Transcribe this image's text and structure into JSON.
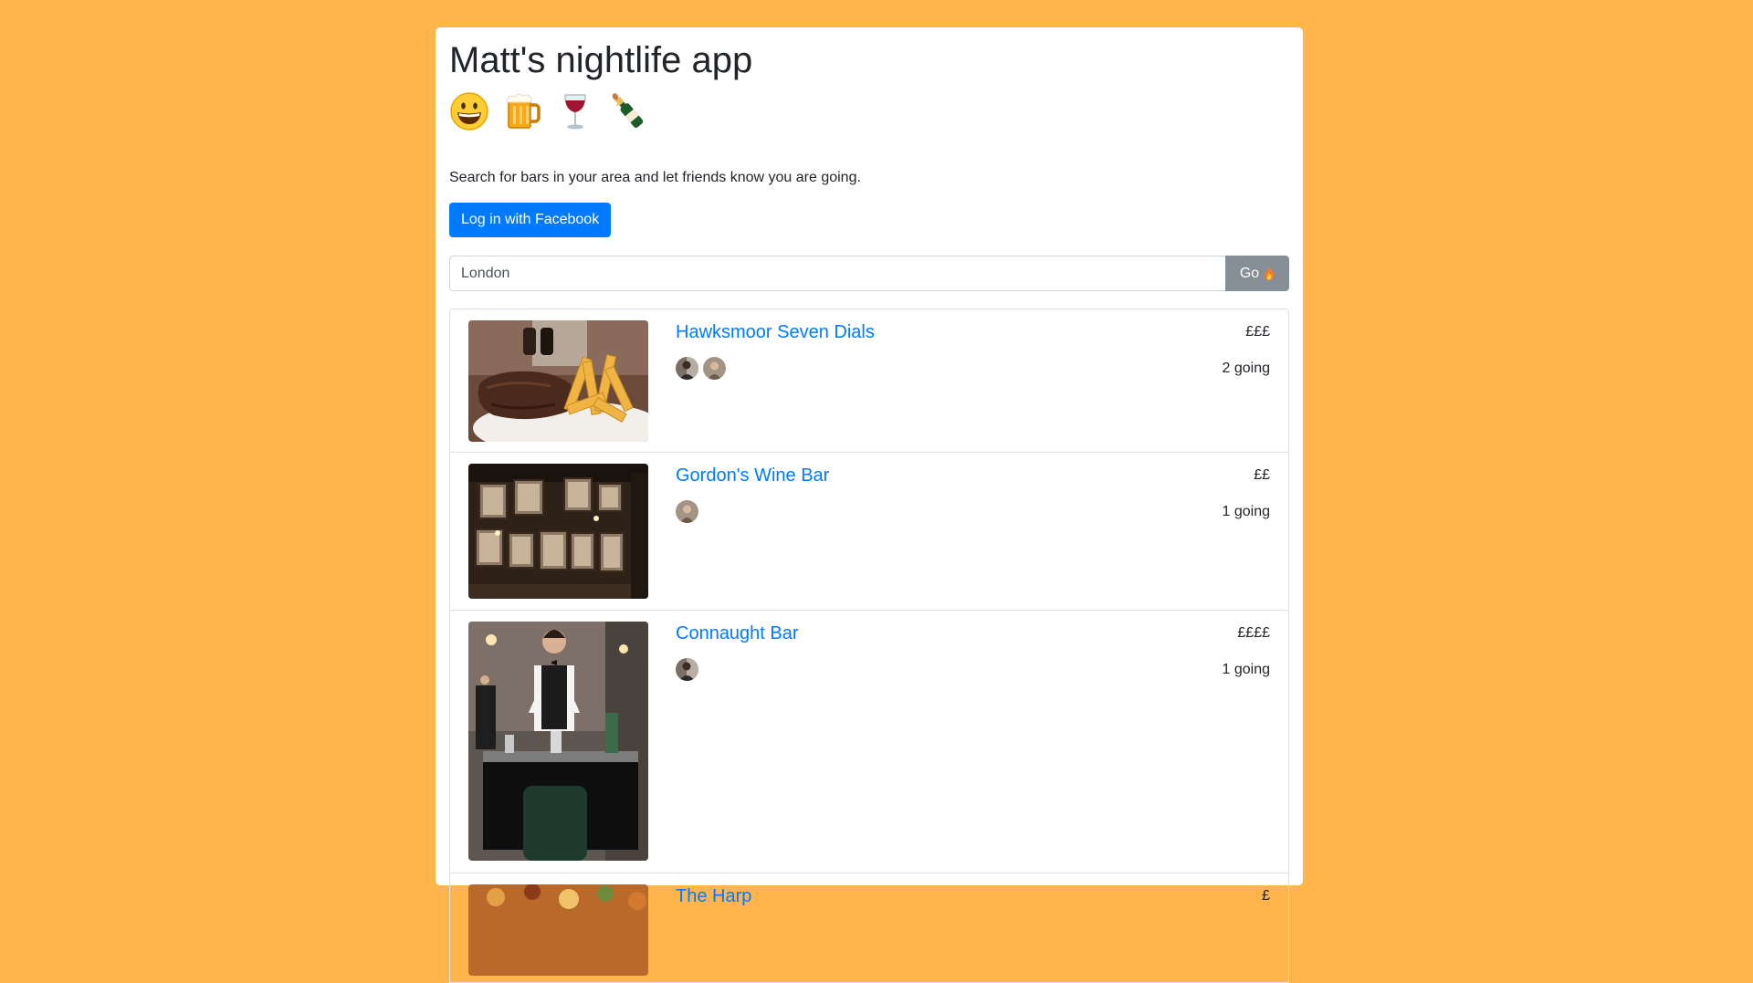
{
  "app": {
    "title": "Matt's nightlife app",
    "subtitle": "Search for bars in your area and let friends know you are going.",
    "emojis": [
      "grinning-face-icon",
      "beer-mug-icon",
      "wine-glass-icon",
      "champagne-bottle-icon"
    ]
  },
  "login": {
    "label": "Log in with Facebook"
  },
  "search": {
    "value": "London",
    "button_label": "Go",
    "button_icon": "fire-icon"
  },
  "bars": [
    {
      "name": "Hawksmoor Seven Dials",
      "price": "£££",
      "going_count": 2,
      "going_label": "2 going",
      "avatars": [
        "avatar-person-1",
        "avatar-person-2"
      ],
      "image": "steak-and-chips-photo"
    },
    {
      "name": "Gordon's Wine Bar",
      "price": "££",
      "going_count": 1,
      "going_label": "1 going",
      "avatars": [
        "avatar-person-2"
      ],
      "image": "wine-bar-wall-photo"
    },
    {
      "name": "Connaught Bar",
      "price": "££££",
      "going_count": 1,
      "going_label": "1 going",
      "avatars": [
        "avatar-person-1"
      ],
      "image": "bartender-photo"
    },
    {
      "name": "The Harp",
      "price": "£",
      "image": "food-photo"
    }
  ],
  "colors": {
    "background": "#ffb54c",
    "primary": "#007bff",
    "secondary": "#868e96",
    "text": "#212529"
  }
}
